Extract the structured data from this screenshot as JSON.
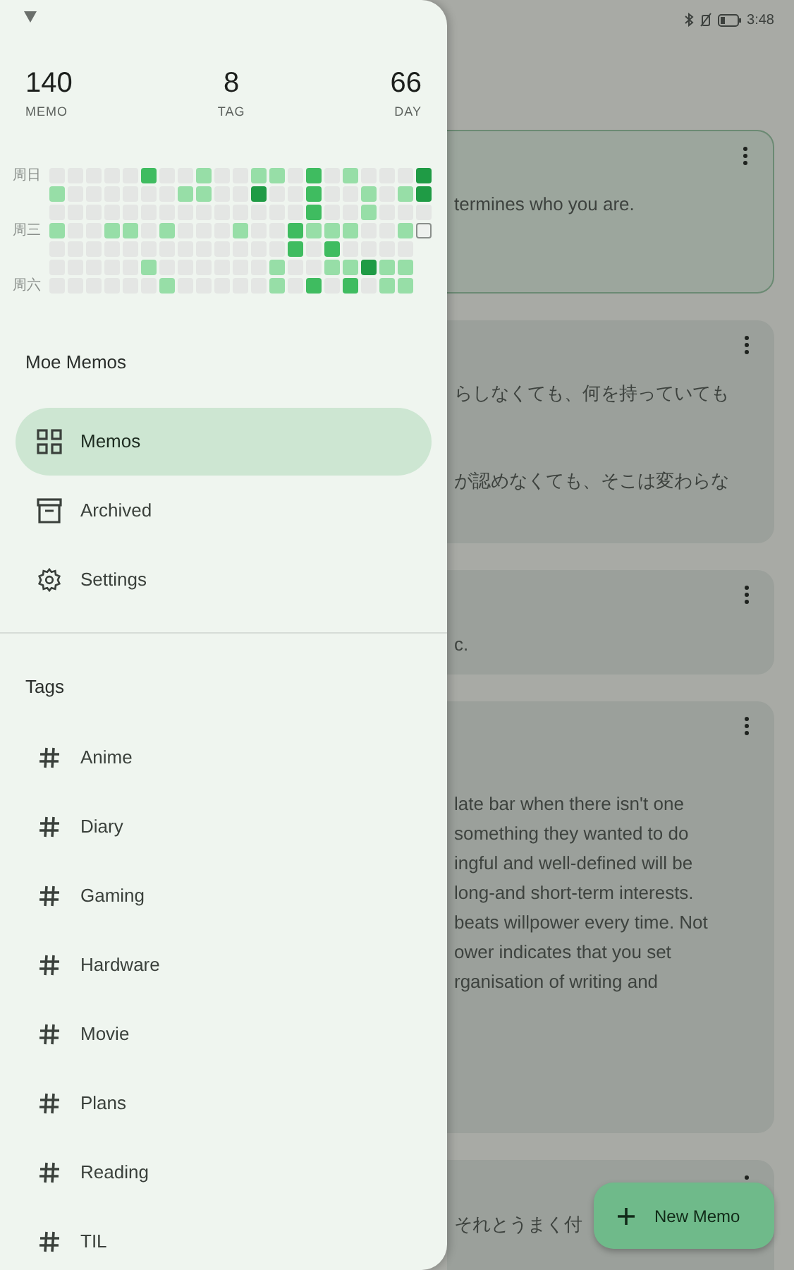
{
  "status_bar": {
    "time": "3:48"
  },
  "stats": [
    {
      "value": "140",
      "label": "MEMO"
    },
    {
      "value": "8",
      "label": "TAG"
    },
    {
      "value": "66",
      "label": "DAY"
    }
  ],
  "heatmap": {
    "rows": [
      {
        "label": "周日",
        "cells": [
          {
            "color": "#e4e6e4"
          },
          {
            "color": "#e4e6e4"
          },
          {
            "color": "#e4e6e4"
          },
          {
            "color": "#e4e6e4"
          },
          {
            "color": "#e4e6e4"
          },
          {
            "color": "#3fbc60"
          },
          {
            "color": "#e4e6e4"
          },
          {
            "color": "#e4e6e4"
          },
          {
            "color": "#97dea7"
          },
          {
            "color": "#e4e6e4"
          },
          {
            "color": "#e4e6e4"
          },
          {
            "color": "#97dea7"
          },
          {
            "color": "#97dea7"
          },
          {
            "color": "#e4e6e4"
          },
          {
            "color": "#3fbc60"
          },
          {
            "color": "#e4e6e4"
          },
          {
            "color": "#97dea7"
          },
          {
            "color": "#e4e6e4"
          },
          {
            "color": "#e4e6e4"
          },
          {
            "color": "#e4e6e4"
          },
          {
            "color": "#1f9b45"
          }
        ]
      },
      {
        "cells": [
          {
            "color": "#97dea7"
          },
          {
            "color": "#e4e6e4"
          },
          {
            "color": "#e4e6e4"
          },
          {
            "color": "#e4e6e4"
          },
          {
            "color": "#e4e6e4"
          },
          {
            "color": "#e4e6e4"
          },
          {
            "color": "#e4e6e4"
          },
          {
            "color": "#97dea7"
          },
          {
            "color": "#97dea7"
          },
          {
            "color": "#e4e6e4"
          },
          {
            "color": "#e4e6e4"
          },
          {
            "color": "#1f9b45"
          },
          {
            "color": "#e4e6e4"
          },
          {
            "color": "#e4e6e4"
          },
          {
            "color": "#3fbc60"
          },
          {
            "color": "#e4e6e4"
          },
          {
            "color": "#e4e6e4"
          },
          {
            "color": "#97dea7"
          },
          {
            "color": "#e4e6e4"
          },
          {
            "color": "#97dea7"
          },
          {
            "color": "#1f9b45"
          }
        ]
      },
      {
        "cells": [
          {
            "color": "#e4e6e4"
          },
          {
            "color": "#e4e6e4"
          },
          {
            "color": "#e4e6e4"
          },
          {
            "color": "#e4e6e4"
          },
          {
            "color": "#e4e6e4"
          },
          {
            "color": "#e4e6e4"
          },
          {
            "color": "#e4e6e4"
          },
          {
            "color": "#e4e6e4"
          },
          {
            "color": "#e4e6e4"
          },
          {
            "color": "#e4e6e4"
          },
          {
            "color": "#e4e6e4"
          },
          {
            "color": "#e4e6e4"
          },
          {
            "color": "#e4e6e4"
          },
          {
            "color": "#e4e6e4"
          },
          {
            "color": "#3fbc60"
          },
          {
            "color": "#e4e6e4"
          },
          {
            "color": "#e4e6e4"
          },
          {
            "color": "#97dea7"
          },
          {
            "color": "#e4e6e4"
          },
          {
            "color": "#e4e6e4"
          },
          {
            "color": "#e4e6e4"
          }
        ]
      },
      {
        "label": "周三",
        "cells": [
          {
            "color": "#97dea7"
          },
          {
            "color": "#e4e6e4"
          },
          {
            "color": "#e4e6e4"
          },
          {
            "color": "#97dea7"
          },
          {
            "color": "#97dea7"
          },
          {
            "color": "#e4e6e4"
          },
          {
            "color": "#97dea7"
          },
          {
            "color": "#e4e6e4"
          },
          {
            "color": "#e4e6e4"
          },
          {
            "color": "#e4e6e4"
          },
          {
            "color": "#97dea7"
          },
          {
            "color": "#e4e6e4"
          },
          {
            "color": "#e4e6e4"
          },
          {
            "color": "#3fbc60"
          },
          {
            "color": "#97dea7"
          },
          {
            "color": "#97dea7"
          },
          {
            "color": "#97dea7"
          },
          {
            "color": "#e4e6e4"
          },
          {
            "color": "#e4e6e4"
          },
          {
            "color": "#97dea7"
          },
          {
            "color": "#eef1ee",
            "outlined": true
          }
        ]
      },
      {
        "cells": [
          {
            "color": "#e4e6e4"
          },
          {
            "color": "#e4e6e4"
          },
          {
            "color": "#e4e6e4"
          },
          {
            "color": "#e4e6e4"
          },
          {
            "color": "#e4e6e4"
          },
          {
            "color": "#e4e6e4"
          },
          {
            "color": "#e4e6e4"
          },
          {
            "color": "#e4e6e4"
          },
          {
            "color": "#e4e6e4"
          },
          {
            "color": "#e4e6e4"
          },
          {
            "color": "#e4e6e4"
          },
          {
            "color": "#e4e6e4"
          },
          {
            "color": "#e4e6e4"
          },
          {
            "color": "#3fbc60"
          },
          {
            "color": "#e4e6e4"
          },
          {
            "color": "#3fbc60"
          },
          {
            "color": "#e4e6e4"
          },
          {
            "color": "#e4e6e4"
          },
          {
            "color": "#e4e6e4"
          },
          {
            "color": "#e4e6e4"
          }
        ]
      },
      {
        "cells": [
          {
            "color": "#e4e6e4"
          },
          {
            "color": "#e4e6e4"
          },
          {
            "color": "#e4e6e4"
          },
          {
            "color": "#e4e6e4"
          },
          {
            "color": "#e4e6e4"
          },
          {
            "color": "#97dea7"
          },
          {
            "color": "#e4e6e4"
          },
          {
            "color": "#e4e6e4"
          },
          {
            "color": "#e4e6e4"
          },
          {
            "color": "#e4e6e4"
          },
          {
            "color": "#e4e6e4"
          },
          {
            "color": "#e4e6e4"
          },
          {
            "color": "#97dea7"
          },
          {
            "color": "#e4e6e4"
          },
          {
            "color": "#e4e6e4"
          },
          {
            "color": "#97dea7"
          },
          {
            "color": "#97dea7"
          },
          {
            "color": "#1f9b45"
          },
          {
            "color": "#97dea7"
          },
          {
            "color": "#97dea7"
          }
        ]
      },
      {
        "label": "周六",
        "cells": [
          {
            "color": "#e4e6e4"
          },
          {
            "color": "#e4e6e4"
          },
          {
            "color": "#e4e6e4"
          },
          {
            "color": "#e4e6e4"
          },
          {
            "color": "#e4e6e4"
          },
          {
            "color": "#e4e6e4"
          },
          {
            "color": "#97dea7"
          },
          {
            "color": "#e4e6e4"
          },
          {
            "color": "#e4e6e4"
          },
          {
            "color": "#e4e6e4"
          },
          {
            "color": "#e4e6e4"
          },
          {
            "color": "#e4e6e4"
          },
          {
            "color": "#97dea7"
          },
          {
            "color": "#e4e6e4"
          },
          {
            "color": "#3fbc60"
          },
          {
            "color": "#e4e6e4"
          },
          {
            "color": "#3fbc60"
          },
          {
            "color": "#e4e6e4"
          },
          {
            "color": "#97dea7"
          },
          {
            "color": "#97dea7"
          }
        ]
      }
    ]
  },
  "drawer": {
    "title": "Moe Memos",
    "nav": [
      {
        "label": "Memos",
        "kind": "grid",
        "selected": true
      },
      {
        "label": "Archived",
        "kind": "archive",
        "selected": false
      },
      {
        "label": "Settings",
        "kind": "gear",
        "selected": false
      }
    ],
    "tags_heading": "Tags",
    "tags": [
      "Anime",
      "Diary",
      "Gaming",
      "Hardware",
      "Movie",
      "Plans",
      "Reading",
      "TIL"
    ]
  },
  "memos": [
    {
      "pinned": true,
      "paragraphs": [
        [
          "termines who you are."
        ]
      ]
    },
    {
      "pinned": false,
      "paragraphs": [
        [
          "らしなくても、何を持っていても"
        ],
        [
          "が認めなくても、そこは変わらな"
        ]
      ]
    },
    {
      "pinned": false,
      "paragraphs": [
        [
          "c."
        ]
      ]
    },
    {
      "pinned": false,
      "paragraphs": [
        [
          "late bar when there isn't one",
          "something they wanted to do",
          "ingful and well-defined will be",
          "long-and short-term interests.",
          "beats willpower every time. Not",
          "ower indicates that you set",
          "rganisation of writing and"
        ]
      ]
    },
    {
      "pinned": false,
      "paragraphs": [
        [
          "それとうまく付"
        ]
      ]
    }
  ],
  "fab": {
    "label": "New Memo"
  }
}
